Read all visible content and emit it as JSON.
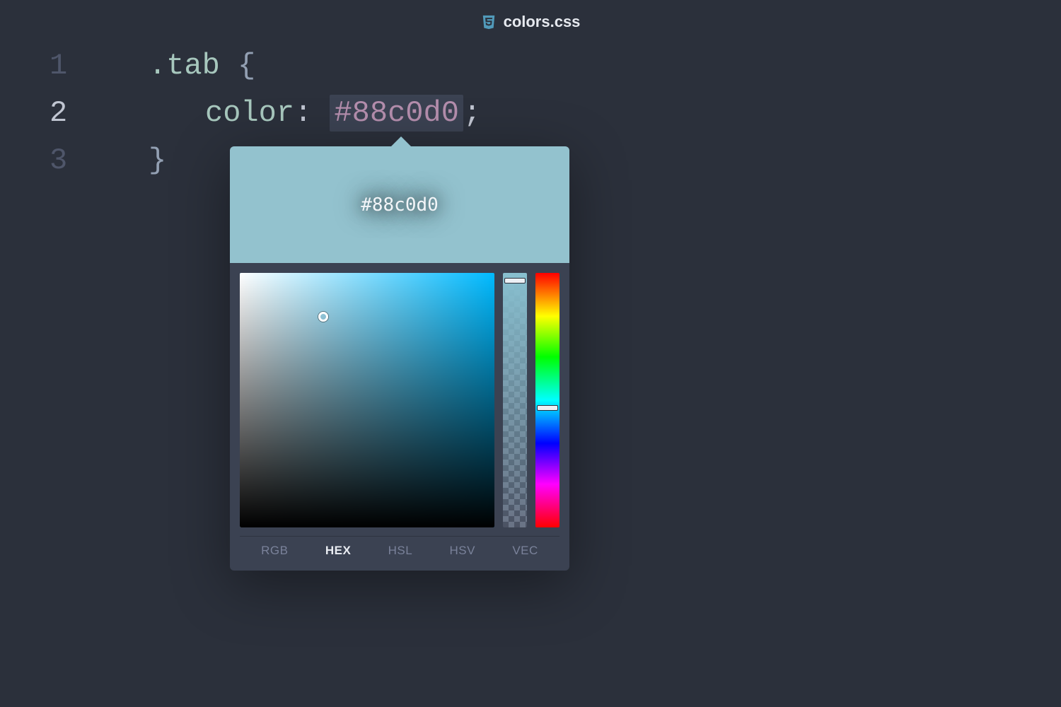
{
  "tab": {
    "filename": "colors.css"
  },
  "editor": {
    "lines": [
      {
        "num": "1",
        "active": false
      },
      {
        "num": "2",
        "active": true
      },
      {
        "num": "3",
        "active": false
      }
    ],
    "selector": ".tab",
    "brace_open": "{",
    "brace_close": "}",
    "property": "color",
    "colon": ":",
    "value": "#88c0d0",
    "semicolon": ";"
  },
  "picker": {
    "swatch_color": "#88c0d0",
    "swatch_label": "#88c0d0",
    "hue_deg": 193,
    "formats": [
      {
        "label": "RGB",
        "active": false
      },
      {
        "label": "HEX",
        "active": true
      },
      {
        "label": "HSL",
        "active": false
      },
      {
        "label": "HSV",
        "active": false
      },
      {
        "label": "VEC",
        "active": false
      }
    ]
  }
}
